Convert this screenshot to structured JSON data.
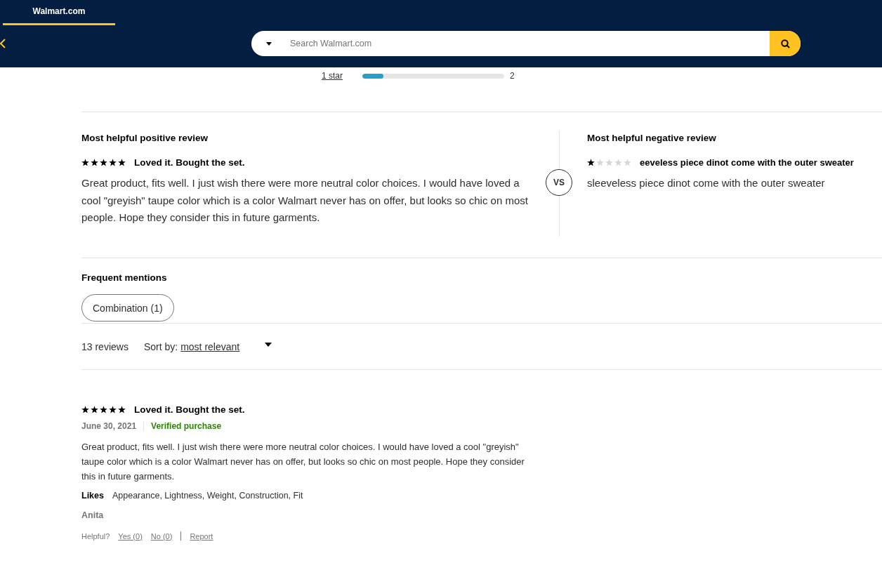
{
  "header": {
    "tab": {
      "label": "Walmart.com",
      "selected": true
    },
    "search": {
      "placeholder": "Search Walmart.com"
    }
  },
  "rating_breakdown": [
    {
      "label": "1 star",
      "level": 0.15,
      "count": "2"
    }
  ],
  "highlights": {
    "positive": {
      "heading": "Most helpful positive review",
      "stars": 5,
      "title": "Loved it. Bought the set.",
      "text": "Great product, fits well. I just wish there were more neutral color choices. I would have loved a cool \"greyish\" taupe color which is a color Walmart never has on offer, but looks so chic on most people. Hope they consider this in future garments."
    },
    "vs": "VS",
    "negative": {
      "heading": "Most helpful negative review",
      "stars": 1,
      "title": "eeveless piece dinot come with the outer sweater",
      "text": "sleeveless piece dinot come with the outer sweater"
    }
  },
  "frequent_mentions": {
    "heading": "Frequent mentions",
    "chips": [
      {
        "label": "Combination (1)",
        "selected": false
      }
    ]
  },
  "reviews_bar": {
    "count": "13 reviews",
    "sort_label": "Sort by:",
    "sort_value": "most relevant"
  },
  "reviews": [
    {
      "stars": 5,
      "title": "Loved it. Bought the set.",
      "date": "June 30, 2021",
      "badge": "Verified purchase",
      "text": "Great product, fits well. I just wish there were more neutral color choices. I would have loved a cool \"greyish\" taupe color which is a color Walmart never has on offer, but looks so chic on most people. Hope they consider this in future garments.",
      "likes_label": "Likes",
      "likes": "Appearance, Lightness, Weight, Construction, Fit",
      "author": "Anita",
      "helpful": "Helpful?",
      "yes": "Yes (0)",
      "no": "No (0)",
      "report": "Report"
    }
  ]
}
